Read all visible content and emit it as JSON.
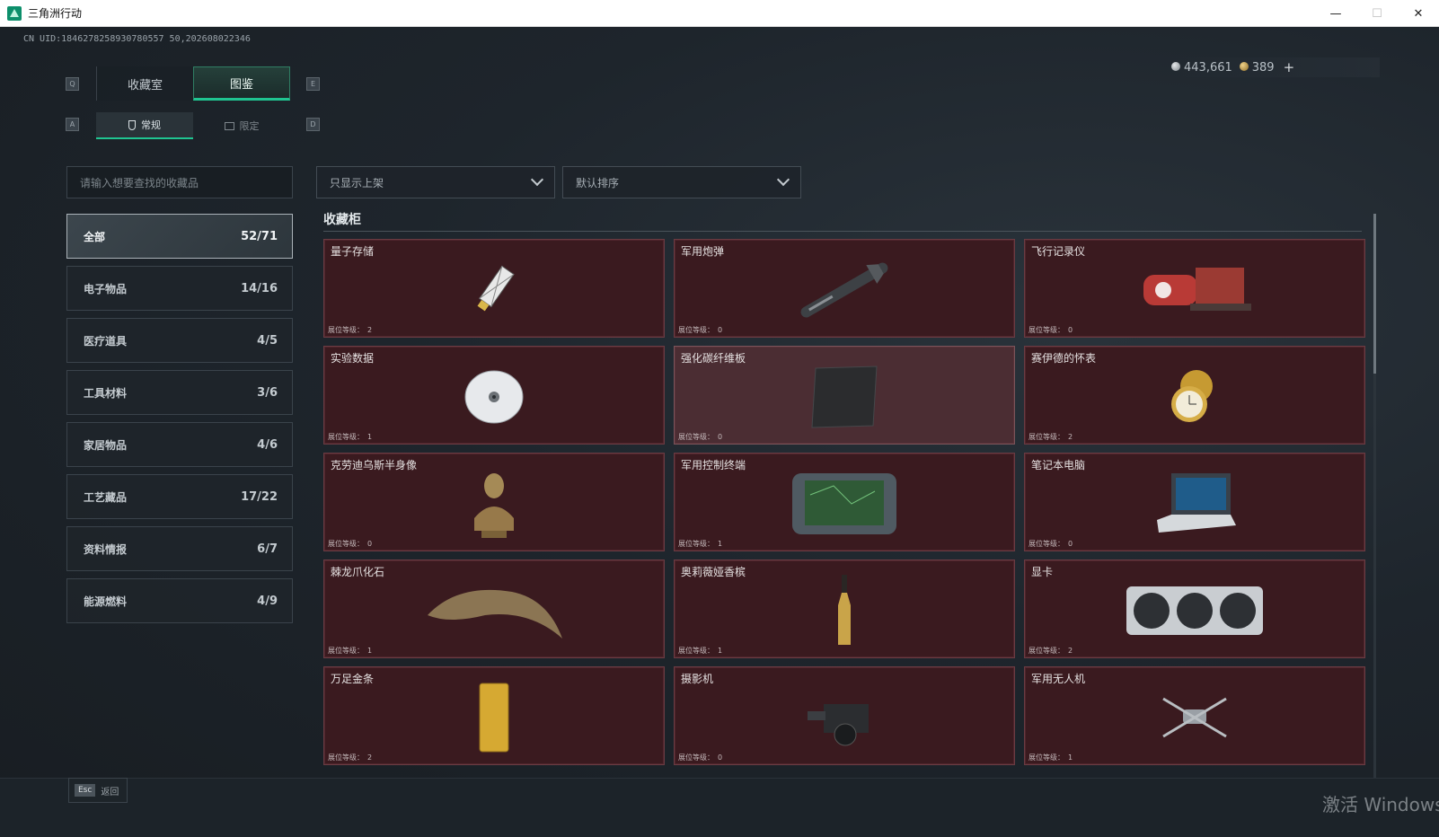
{
  "window": {
    "title": "三角洲行动",
    "controls": [
      "—",
      "☐",
      "✕"
    ]
  },
  "header": {
    "uid": "CN UID:1846278258930780557 50,202608022346",
    "currency": {
      "silver": "443,661",
      "gold": "389",
      "add": "+"
    }
  },
  "keys": {
    "prev_tab": "Q",
    "next_tab": "E",
    "prev_sub": "A",
    "next_sub": "D"
  },
  "tabs": [
    {
      "label": "收藏室",
      "active": false
    },
    {
      "label": "图鉴",
      "active": true
    }
  ],
  "sub_tabs": [
    {
      "label": "常规",
      "icon": "flask-icon",
      "active": true
    },
    {
      "label": "限定",
      "icon": "picture-icon",
      "active": false
    }
  ],
  "search": {
    "placeholder": "请输入想要查找的收藏品"
  },
  "filters": {
    "display": "只显示上架",
    "sort": "默认排序"
  },
  "categories": [
    {
      "label": "全部",
      "count": "52/71",
      "active": true
    },
    {
      "label": "电子物品",
      "count": "14/16"
    },
    {
      "label": "医疗道具",
      "count": "4/5"
    },
    {
      "label": "工具材料",
      "count": "3/6"
    },
    {
      "label": "家居物品",
      "count": "4/6"
    },
    {
      "label": "工艺藏品",
      "count": "17/22"
    },
    {
      "label": "资料情报",
      "count": "6/7"
    },
    {
      "label": "能源燃料",
      "count": "4/9"
    }
  ],
  "section_title": "收藏柜",
  "level_label": "展位等级：",
  "items": [
    {
      "name": "量子存储",
      "level": "2",
      "icon": "usb-drive-icon"
    },
    {
      "name": "军用炮弹",
      "level": "0",
      "icon": "missile-icon"
    },
    {
      "name": "飞行记录仪",
      "level": "0",
      "icon": "flight-recorder-icon"
    },
    {
      "name": "实验数据",
      "level": "1",
      "icon": "disc-icon"
    },
    {
      "name": "强化碳纤维板",
      "level": "0",
      "icon": "carbon-plate-icon"
    },
    {
      "name": "赛伊德的怀表",
      "level": "2",
      "icon": "pocket-watch-icon"
    },
    {
      "name": "克劳迪乌斯半身像",
      "level": "0",
      "icon": "bust-icon"
    },
    {
      "name": "军用控制终端",
      "level": "1",
      "icon": "control-terminal-icon"
    },
    {
      "name": "笔记本电脑",
      "level": "0",
      "icon": "laptop-icon"
    },
    {
      "name": "棘龙爪化石",
      "level": "1",
      "icon": "claw-fossil-icon"
    },
    {
      "name": "奥莉薇娅香槟",
      "level": "1",
      "icon": "champagne-icon"
    },
    {
      "name": "显卡",
      "level": "2",
      "icon": "graphics-card-icon"
    },
    {
      "name": "万足金条",
      "level": "2",
      "icon": "gold-bar-icon"
    },
    {
      "name": "摄影机",
      "level": "0",
      "icon": "camera-icon"
    },
    {
      "name": "军用无人机",
      "level": "1",
      "icon": "drone-icon"
    }
  ],
  "footer": {
    "esc_key": "Esc",
    "back_label": "返回"
  },
  "watermark": "激活 Windows",
  "colors": {
    "accent": "#1fc591",
    "card_bg": "#3a1a1f",
    "card_border": "#6b3c43"
  }
}
